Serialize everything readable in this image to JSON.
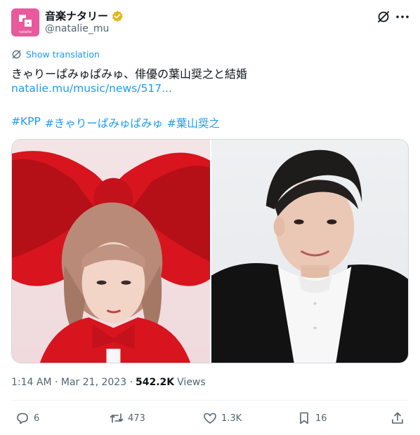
{
  "author": {
    "display_name": "音楽ナタリー",
    "handle": "@natalie_mu",
    "avatar_brand": "natalie",
    "avatar_color": "#e85a9c",
    "verified_badge_color": "#e2b719"
  },
  "header_icons": [
    "grok-icon",
    "more-icon"
  ],
  "translation_label": "Show translation",
  "tweet": {
    "text": "きゃりーぱみゅぱみゅ、俳優の葉山奨之と結婚",
    "link": "natalie.mu/music/news/517...",
    "hashtags": [
      "#KPP",
      "#きゃりーぱみゅぱみゅ",
      "#葉山奨之"
    ]
  },
  "media": {
    "left_icon": "photo-of-woman-with-red-bow",
    "right_icon": "photo-of-man-in-black-and-white-shirt"
  },
  "meta": {
    "timestamp": "1:14 AM · Mar 21, 2023 · ",
    "views_count": "542.2K",
    "views_label": "Views"
  },
  "actions": {
    "replies": "6",
    "reposts": "473",
    "likes": "1.3K",
    "bookmarks": "16"
  },
  "colors": {
    "link": "#1d9bf0",
    "secondary_text": "#536471",
    "primary_text": "#0f1419"
  }
}
